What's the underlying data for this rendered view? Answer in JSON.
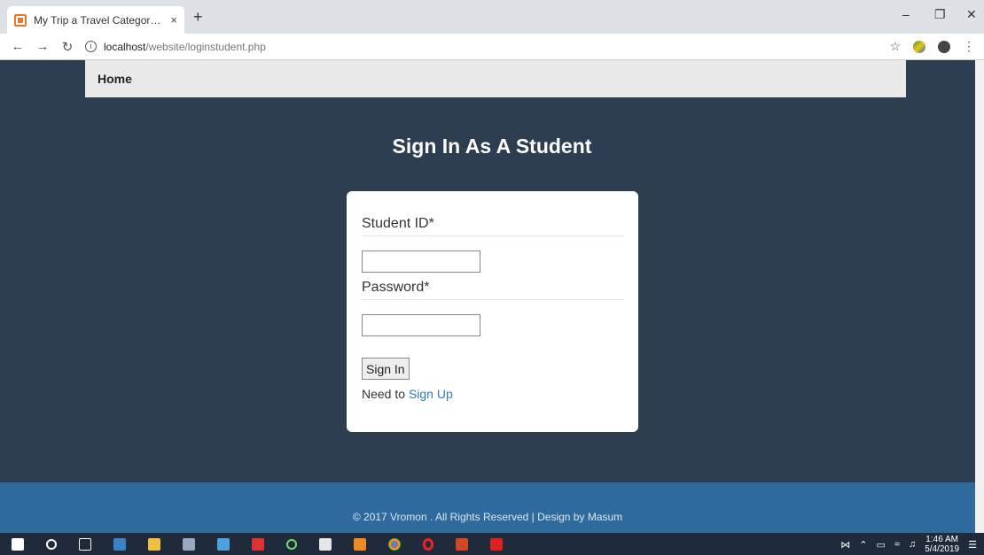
{
  "browser": {
    "tab_title": "My Trip a Travel Category Flat Bo",
    "tab_close": "×",
    "new_tab": "+",
    "url_host": "localhost",
    "url_path": "/website/loginstudent.php",
    "icons": {
      "back": "back-arrow-icon",
      "forward": "forward-arrow-icon",
      "reload": "reload-icon",
      "info": "info-icon",
      "star": "star-icon",
      "extension": "extension-icon",
      "account": "account-icon",
      "menu": "menu-icon"
    }
  },
  "nav": {
    "home_label": "Home"
  },
  "page": {
    "title": "Sign In As A Student"
  },
  "form": {
    "student_id_label": "Student ID*",
    "password_label": "Password*",
    "submit_label": "Sign In",
    "signup_prefix": "Need to",
    "signup_link": "Sign Up"
  },
  "footer": {
    "text": "© 2017 Vromon . All Rights Reserved | Design by Masum"
  },
  "taskbar": {
    "time": "1:46 AM",
    "date": "5/4/2019",
    "apps": [
      "windows-start-icon",
      "cortana-icon",
      "task-view-icon",
      "remote-desktop-icon",
      "file-explorer-icon",
      "paint-icon",
      "tool-icon",
      "red-app-icon",
      "upwork-icon",
      "pen-icon",
      "sublime-icon",
      "chrome-icon",
      "opera-icon",
      "powerpoint-icon",
      "acrobat-icon"
    ]
  },
  "colors": {
    "page_bg": "#2c3e50",
    "footer_bg": "#2e6a9e",
    "link": "#337ab7"
  }
}
